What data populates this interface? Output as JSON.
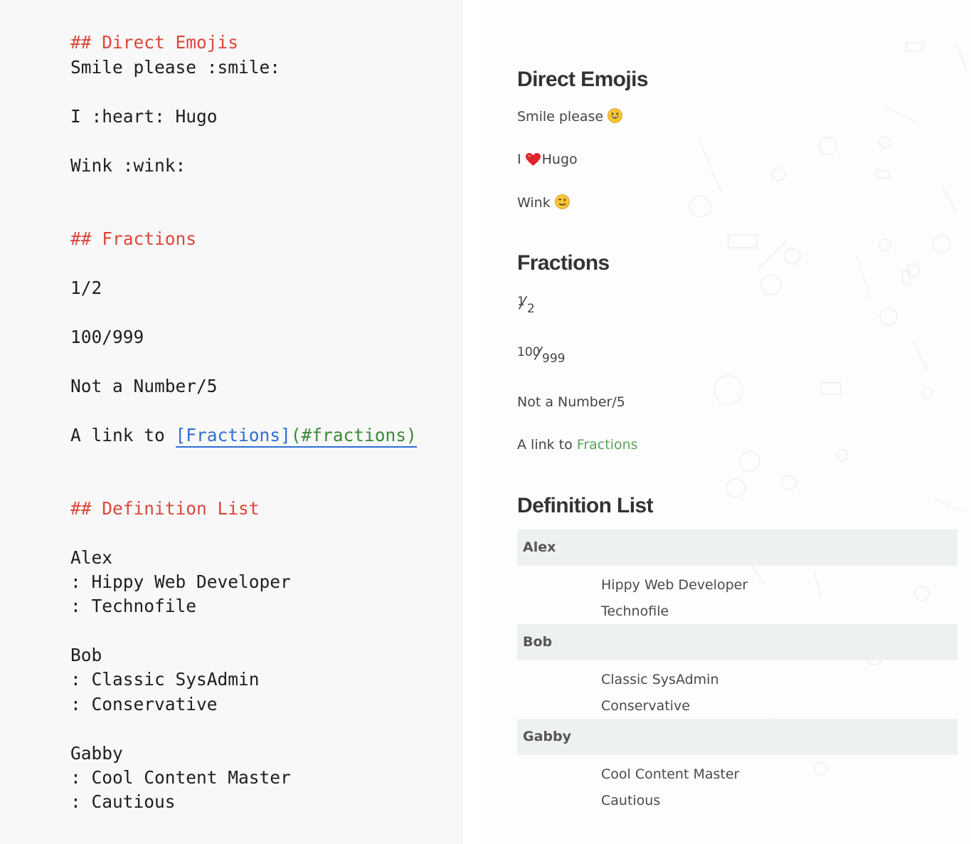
{
  "source": {
    "heading_emojis": "## Direct Emojis",
    "smile_line": "Smile please :smile:",
    "heart_line": "I :heart: Hugo",
    "wink_line": "Wink :wink:",
    "heading_fractions": "## Fractions",
    "frac_half": "1/2",
    "frac_big": "100/999",
    "not_number": "Not a Number/5",
    "link_prefix": "A link to ",
    "link_text": "[Fractions]",
    "link_url": "(#fractions)",
    "heading_deflist": "## Definition List",
    "alex": "Alex",
    "alex_def1": ": Hippy Web Developer",
    "alex_def2": ": Technofile",
    "bob": "Bob",
    "bob_def1": ": Classic SysAdmin",
    "bob_def2": ": Conservative",
    "gabby": "Gabby",
    "gabby_def1": ": Cool Content Master",
    "gabby_def2": ": Cautious"
  },
  "preview": {
    "heading_emojis": "Direct Emojis",
    "smile_text": "Smile please",
    "heart_before": "I",
    "heart_after": "Hugo",
    "wink_text": "Wink",
    "heading_fractions": "Fractions",
    "half_num": "1",
    "half_slash": "⁄",
    "half_den": "2",
    "big_num": "100",
    "big_slash": "⁄",
    "big_den": "999",
    "not_number": "Not a Number/5",
    "link_prefix": "A link to ",
    "link_text": "Fractions",
    "heading_deflist": "Definition List",
    "terms": [
      {
        "term": "Alex",
        "defs": [
          "Hippy Web Developer",
          "Technofile"
        ]
      },
      {
        "term": "Bob",
        "defs": [
          "Classic SysAdmin",
          "Conservative"
        ]
      },
      {
        "term": "Gabby",
        "defs": [
          "Cool Content Master",
          "Cautious"
        ]
      }
    ]
  },
  "icons": {
    "smile": "smile-emoji-icon",
    "heart": "heart-emoji-icon",
    "wink": "wink-emoji-icon"
  },
  "colors": {
    "markdown_heading": "#d9483b",
    "markdown_link_text": "#2f6fd6",
    "markdown_link_url": "#3a8a3a",
    "preview_link": "#5aa35a",
    "term_background": "#eef2ee"
  }
}
